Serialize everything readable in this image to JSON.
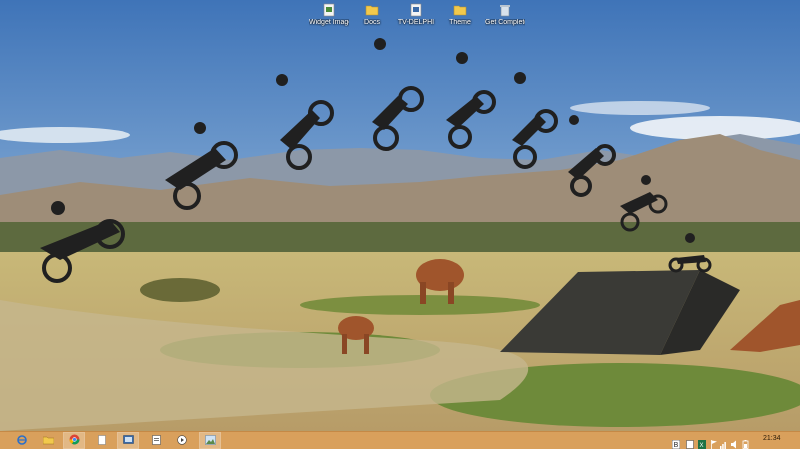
{
  "desktop": {
    "icons": [
      {
        "name": "file-icon",
        "label": "Widget Images"
      },
      {
        "name": "folder-icon",
        "label": "Docs"
      },
      {
        "name": "file-icon",
        "label": "TV-DELPHI"
      },
      {
        "name": "folder-icon",
        "label": "Theme"
      },
      {
        "name": "recycle-bin-icon",
        "label": "Get Complete"
      }
    ]
  },
  "taskbar": {
    "color": "#d9a05c",
    "buttons": [
      {
        "name": "internet-explorer-icon"
      },
      {
        "name": "file-explorer-icon"
      },
      {
        "name": "chrome-icon"
      },
      {
        "name": "blank-document-icon"
      },
      {
        "name": "control-panel-icon"
      },
      {
        "name": "document-icon"
      },
      {
        "name": "media-icon"
      },
      {
        "name": "photos-icon"
      }
    ],
    "tray": {
      "icons": [
        "b-app-icon",
        "notepad-icon",
        "excel-icon",
        "flag-icon",
        "signal-icon",
        "volume-icon",
        "battery-icon"
      ],
      "clock": "21:34"
    }
  }
}
